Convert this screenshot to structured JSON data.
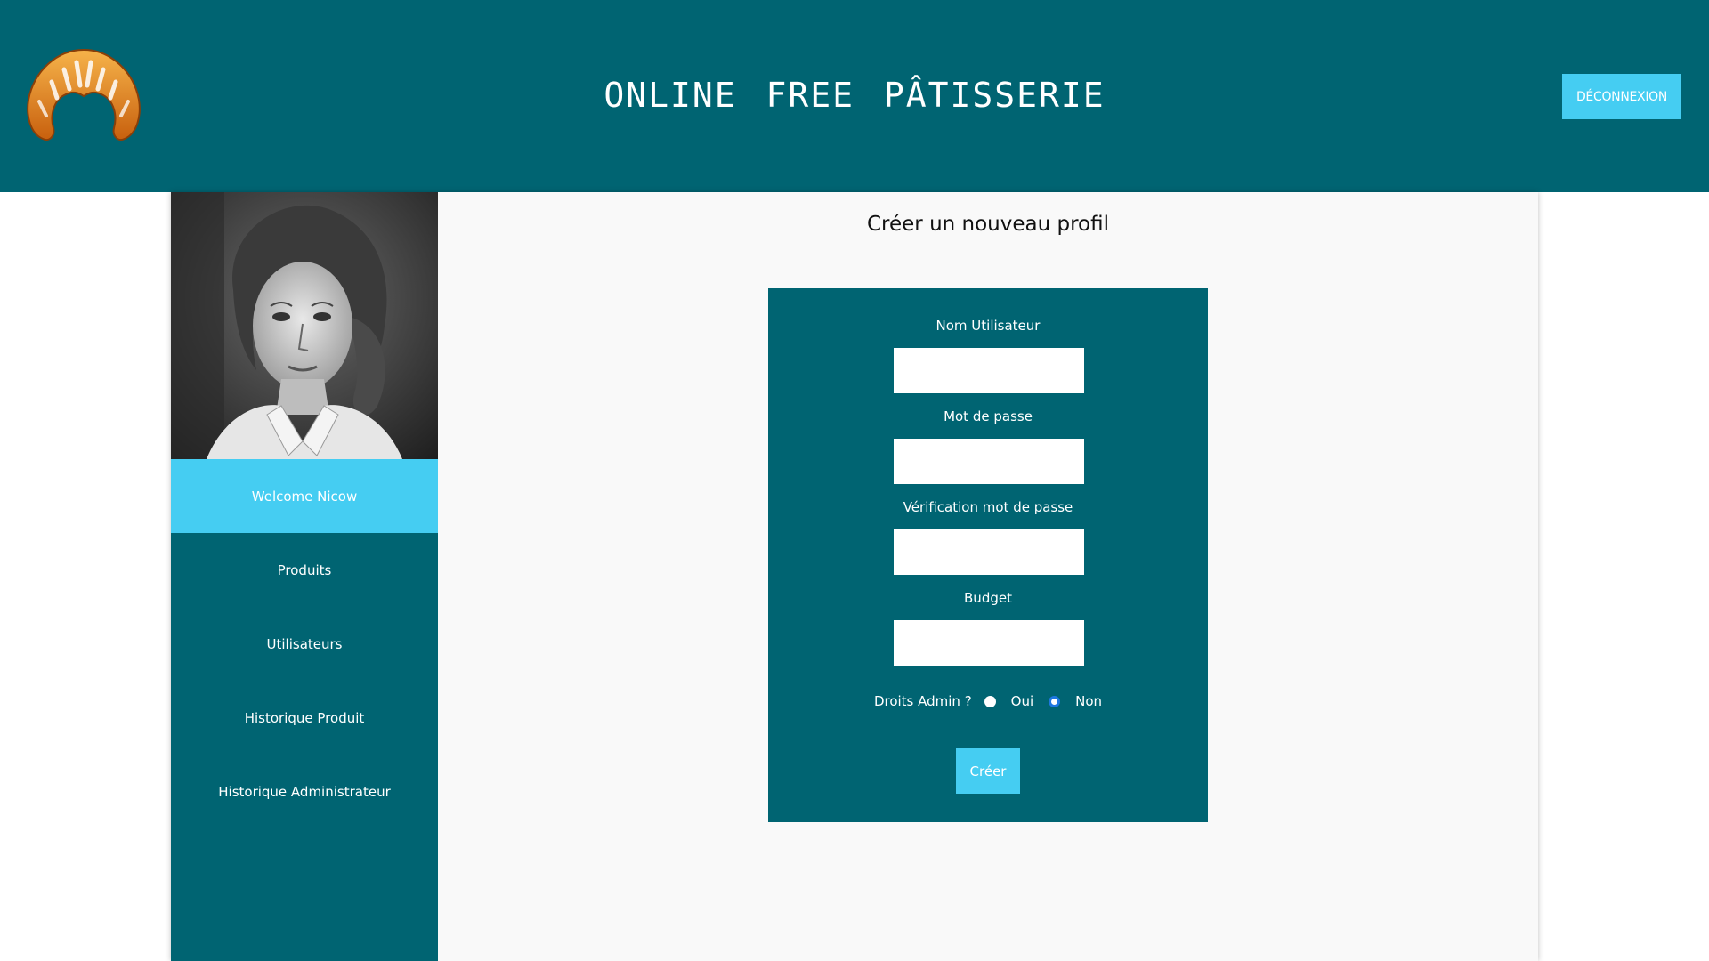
{
  "header": {
    "site_title": "ONLINE FREE PÂTISSERIE",
    "logout_label": "DÉCONNEXION",
    "logo_icon": "croissant-icon"
  },
  "sidebar": {
    "avatar_icon": "user-portrait",
    "welcome": "Welcome Nicow",
    "items": [
      {
        "label": "Produits"
      },
      {
        "label": "Utilisateurs"
      },
      {
        "label": "Historique Produit"
      },
      {
        "label": "Historique Administrateur"
      }
    ]
  },
  "main": {
    "heading": "Créer un nouveau profil",
    "form": {
      "username_label": "Nom Utilisateur",
      "username_value": "",
      "password_label": "Mot de passe",
      "password_value": "",
      "password_confirm_label": "Vérification mot de passe",
      "password_confirm_value": "",
      "budget_label": "Budget",
      "budget_value": "",
      "admin_label": "Droits Admin ?",
      "admin_options": [
        "Oui",
        "Non"
      ],
      "admin_selected": "Non",
      "submit_label": "Créer"
    }
  },
  "colors": {
    "primary": "#006472",
    "accent": "#45cdf2",
    "background": "#f9f9f9"
  }
}
